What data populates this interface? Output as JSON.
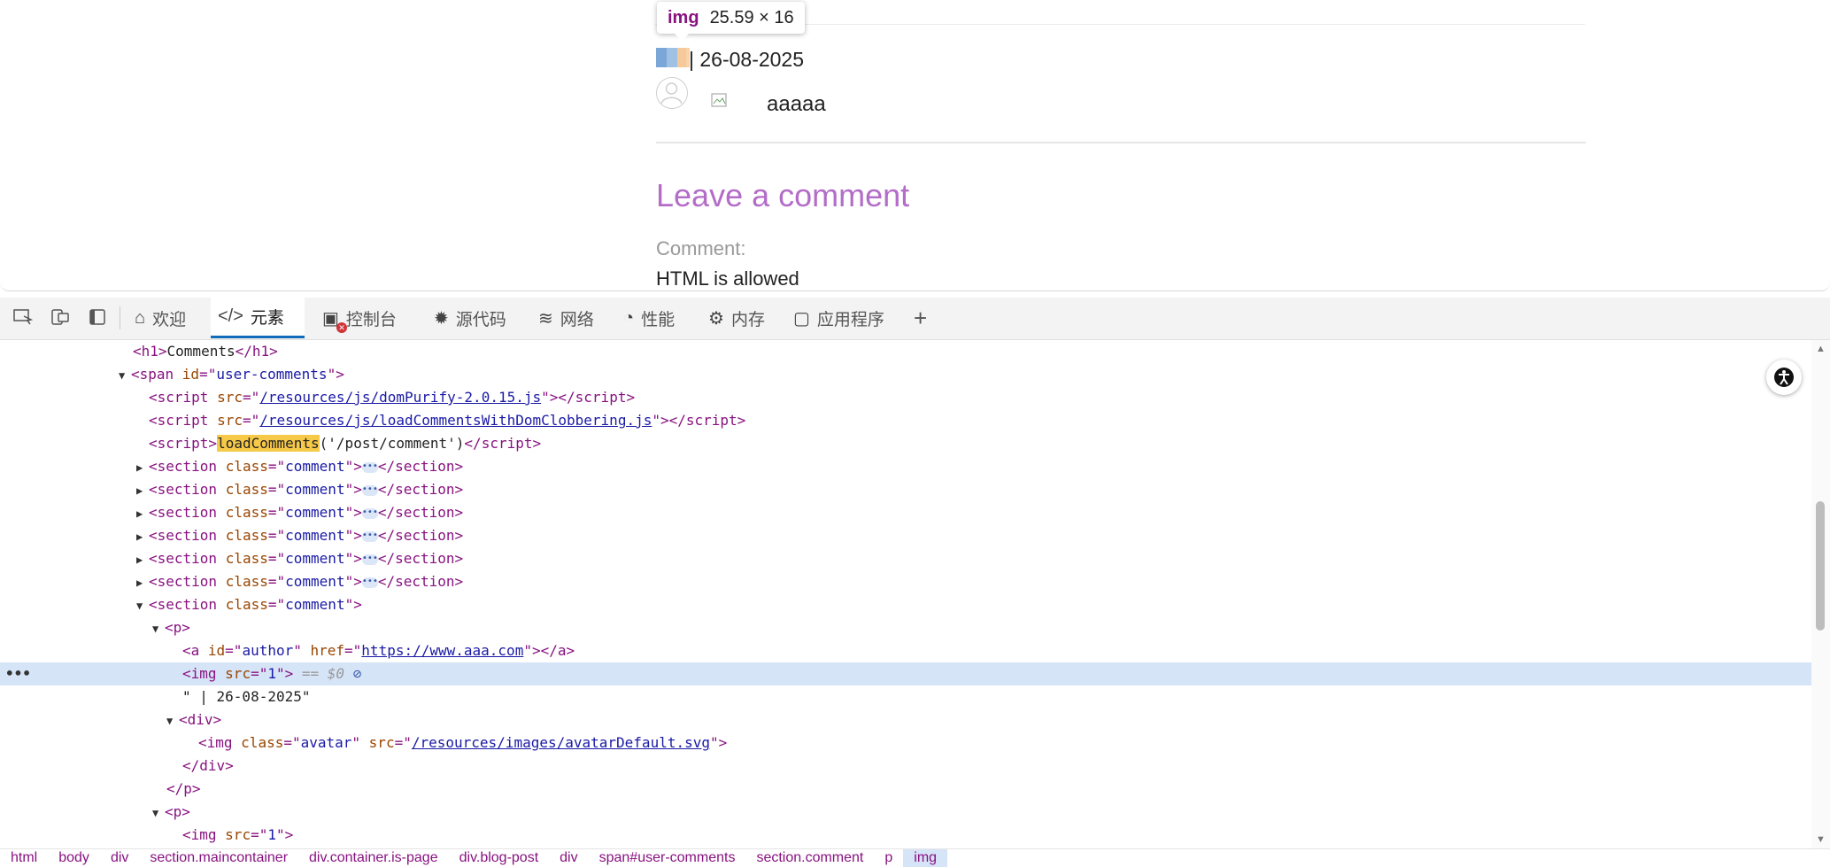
{
  "page": {
    "tooltip": {
      "tag": "img",
      "dims": "25.59 × 16"
    },
    "comment_date": "| 26-08-2025",
    "comment_text": "aaaaa",
    "leave_heading": "Leave a comment",
    "comment_label": "Comment:",
    "html_allowed": "HTML is allowed"
  },
  "devtools": {
    "tabs": [
      {
        "label": "欢迎",
        "icon": "home-icon"
      },
      {
        "label": "元素",
        "icon": "code-icon"
      },
      {
        "label": "控制台",
        "icon": "console-icon"
      },
      {
        "label": "源代码",
        "icon": "bug-icon"
      },
      {
        "label": "网络",
        "icon": "wifi-icon"
      },
      {
        "label": "性能",
        "icon": "gauge-icon"
      },
      {
        "label": "内存",
        "icon": "chip-icon"
      },
      {
        "label": "应用程序",
        "icon": "app-icon"
      }
    ],
    "add_tab": "+",
    "active_tab": "元素"
  },
  "dom": {
    "h1_text": "Comments",
    "span_id": "user-comments",
    "script1_src": "/resources/js/domPurify-2.0.15.js",
    "script2_src": "/resources/js/loadCommentsWithDomClobbering.js",
    "script3_fn": "loadComments",
    "script3_args": "('/post/comment')",
    "section_class": "comment",
    "a_id": "author",
    "a_href": "https://www.aaa.com",
    "img_src": "1",
    "selected_marker": "== $0",
    "text_node": "\" | 26-08-2025\"",
    "avatar_class": "avatar",
    "avatar_src": "/resources/images/avatarDefault.svg"
  },
  "breadcrumbs": [
    "html",
    "body",
    "div",
    "section.maincontainer",
    "div.container.is-page",
    "div.blog-post",
    "div",
    "span#user-comments",
    "section.comment",
    "p",
    "img"
  ]
}
